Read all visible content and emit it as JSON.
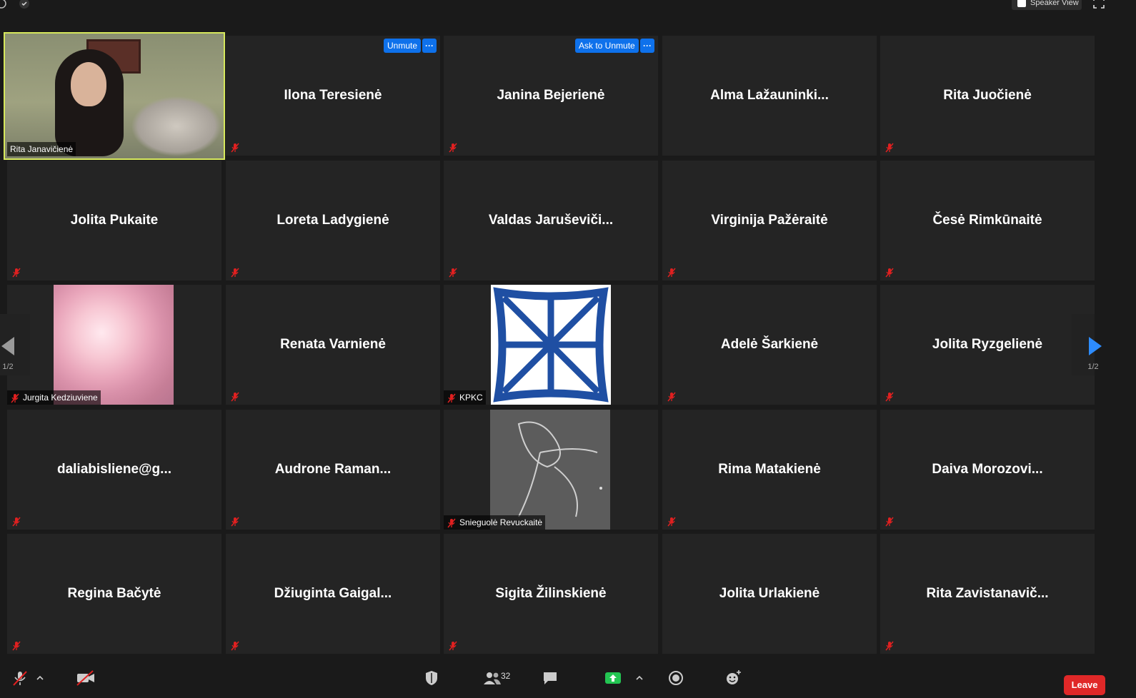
{
  "topbar": {
    "speaker_view_label": "Speaker View"
  },
  "tiles": [
    {
      "name": "Rita Janavičienė"
    },
    {
      "name": "Ilona Teresienė"
    },
    {
      "name": "Janina Bejerienė"
    },
    {
      "name": "Alma  Lažauninki..."
    },
    {
      "name": "Rita Juočienė"
    },
    {
      "name": "Jolita Pukaite"
    },
    {
      "name": "Loreta Ladygienė"
    },
    {
      "name": "Valdas  Jaruševiči..."
    },
    {
      "name": "Virginija Pažėraitė"
    },
    {
      "name": "Česė Rimkūnaitė"
    },
    {
      "name": "Jurgita Kedziuviene"
    },
    {
      "name": "Renata Varnienė"
    },
    {
      "name": "KPKC"
    },
    {
      "name": "Adelė Šarkienė"
    },
    {
      "name": "Jolita Ryzgelienė"
    },
    {
      "name": "daliabisliene@g..."
    },
    {
      "name": "Audrone  Raman..."
    },
    {
      "name": "Snieguolė Revuckaitė"
    },
    {
      "name": "Rima Matakienė"
    },
    {
      "name": "Daiva  Morozovi..."
    },
    {
      "name": "Regina Bačytė"
    },
    {
      "name": "Džiuginta  Gaigal..."
    },
    {
      "name": "Sigita Žilinskienė"
    },
    {
      "name": "Jolita Urlakienė"
    },
    {
      "name": "Rita  Zavistanavič..."
    }
  ],
  "tile_actions": {
    "unmute_label": "Unmute",
    "ask_to_unmute_label": "Ask to Unmute",
    "more_label": "···"
  },
  "pagination": {
    "left_label": "1/2",
    "right_label": "1/2"
  },
  "toolbar": {
    "participants_count": "32",
    "leave_label": "Leave"
  },
  "colors": {
    "active_speaker_border": "#d6e85c",
    "accent_blue": "#0e71eb",
    "leave_red": "#e02828",
    "share_green": "#23c552",
    "muted_red": "#e02020"
  }
}
